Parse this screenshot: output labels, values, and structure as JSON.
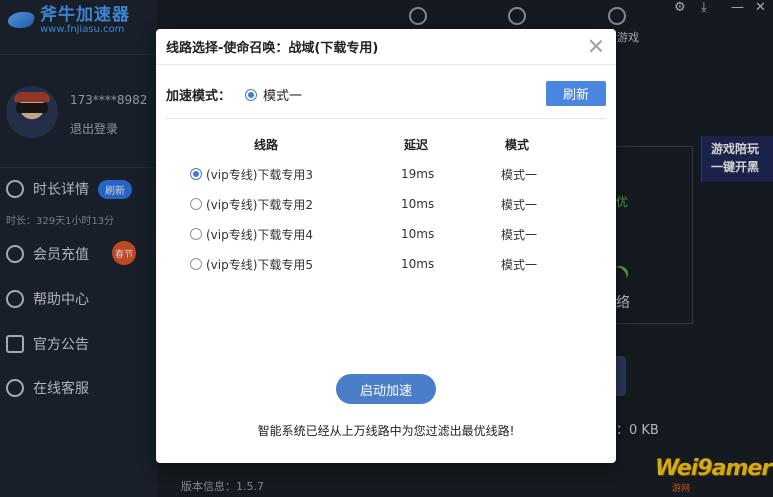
{
  "app": {
    "logo_title": "斧牛加速器",
    "logo_url": "www.fnjiasu.com",
    "phone": "173****8982",
    "logout": "退出登录",
    "duration": "时长：329天1小时13分",
    "version": "版本信息：1.5.7",
    "festival_badge": "春节",
    "nav": [
      {
        "label": "时长详情",
        "badge": "刷新"
      },
      {
        "label": "会员充值"
      },
      {
        "label": "帮助中心"
      },
      {
        "label": "官方公告"
      },
      {
        "label": "在线客服"
      }
    ],
    "top_tab_partial": "游戏",
    "promo": [
      "游戏陪玩",
      "一键开黑"
    ],
    "bg_status_partial": "优",
    "bg_network_partial": "络",
    "bg_traffic_partial": "：0 KB",
    "watermark": "Wei9amer",
    "watermark_sub": "游网"
  },
  "modal": {
    "title": "线路选择-使命召唤：战域(下载专用)",
    "mode_label": "加速模式：",
    "mode_option": "模式一",
    "refresh_label": "刷新",
    "columns": {
      "route": "线路",
      "latency": "延迟",
      "mode": "模式"
    },
    "rows": [
      {
        "name": "(vip专线)下载专用3",
        "latency": "19ms",
        "mode": "模式一",
        "selected": true
      },
      {
        "name": "(vip专线)下载专用2",
        "latency": "10ms",
        "mode": "模式一",
        "selected": false
      },
      {
        "name": "(vip专线)下载专用4",
        "latency": "10ms",
        "mode": "模式一",
        "selected": false
      },
      {
        "name": "(vip专线)下载专用5",
        "latency": "10ms",
        "mode": "模式一",
        "selected": false
      }
    ],
    "start_label": "启动加速",
    "footer_note": "智能系统已经从上万线路中为您过滤出最优线路!"
  }
}
